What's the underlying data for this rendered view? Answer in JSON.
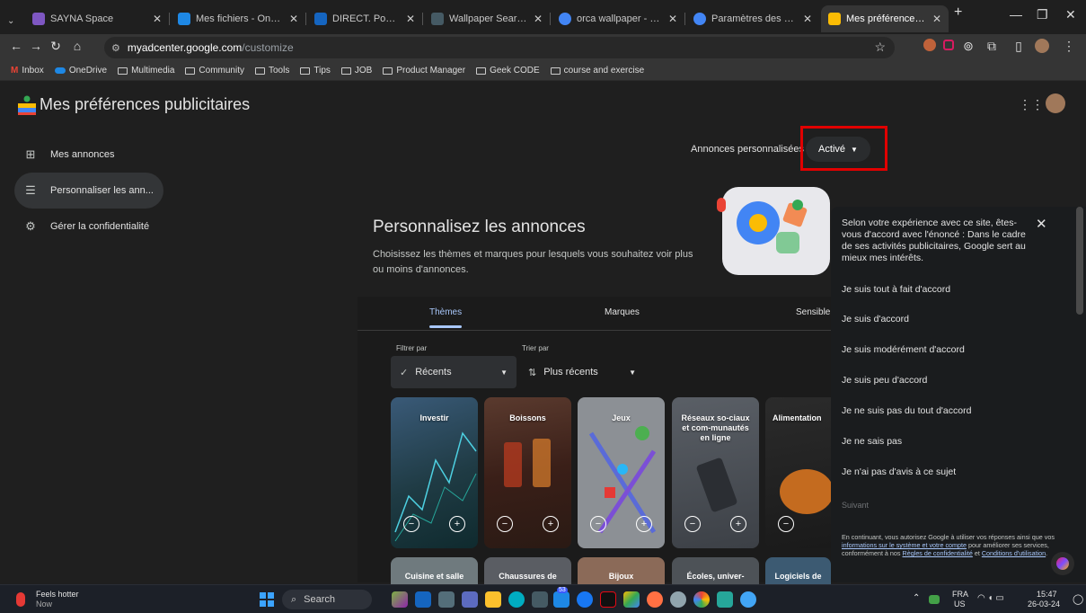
{
  "browser": {
    "tabs": [
      {
        "title": "SAYNA Space",
        "color": "#7e57c2"
      },
      {
        "title": "Mes fichiers - OneDrive",
        "color": "#1e88e5"
      },
      {
        "title": "DIRECT. Pont effondré à B",
        "color": "#1565c0"
      },
      {
        "title": "Wallpaper Search: orca -",
        "color": "#455a64"
      },
      {
        "title": "orca wallpaper - Recherch",
        "color": "#4285f4"
      },
      {
        "title": "Paramètres des annonces",
        "color": "#4285f4"
      },
      {
        "title": "Mes préférences publicita",
        "color": "#fbbc04"
      }
    ],
    "new_tab": "+",
    "address_host": "myadcenter.google.com",
    "address_path": "/customize",
    "bookmarks": [
      "Inbox",
      "OneDrive",
      "Multimedia",
      "Community",
      "Tools",
      "Tips",
      "JOB",
      "Product Manager",
      "Geek CODE",
      "course and exercise"
    ]
  },
  "app": {
    "title": "Mes préférences publicitaires",
    "sidebar": [
      {
        "label": "Mes annonces",
        "icon": "ads-grid-icon"
      },
      {
        "label": "Personnaliser les ann...",
        "icon": "tune-icon"
      },
      {
        "label": "Gérer la confidentialité",
        "icon": "privacy-icon"
      }
    ],
    "personalized_label": "Annonces personnalisées",
    "active_label": "Activé",
    "heading": "Personnalisez les annonces",
    "description": "Choisissez les thèmes et marques pour lesquels vous souhaitez voir plus ou moins d'annonces.",
    "content_tabs": [
      "Thèmes",
      "Marques",
      "Sensible"
    ],
    "filter": {
      "label": "Filtrer par",
      "value": "Récents"
    },
    "sort": {
      "label": "Trier par",
      "value": "Plus récents"
    },
    "cards": [
      "Investir",
      "Boissons",
      "Jeux",
      "Réseaux so-ciaux et com-munautés en ligne",
      "Alimentation"
    ],
    "cards_row2": [
      "Cuisine et salle",
      "Chaussures de",
      "Bijoux",
      "Écoles, univer-",
      "Logiciels de"
    ]
  },
  "survey": {
    "question": "Selon votre expérience avec ce site, êtes-vous d'accord avec l'énoncé : Dans le cadre de ses activités publicitaires, Google sert au mieux mes intérêts.",
    "options": [
      "Je suis tout à fait d'accord",
      "Je suis d'accord",
      "Je suis modérément d'accord",
      "Je suis peu d'accord",
      "Je ne suis pas du tout d'accord",
      "Je ne sais pas",
      "Je n'ai pas d'avis à ce sujet"
    ],
    "next": "Suivant",
    "fine_a": "En continuant, vous autorisez Google à utiliser vos réponses ainsi que vos ",
    "fine_link1": "informations sur le système et votre compte",
    "fine_b": " pour améliorer ses services, conformément à nos ",
    "fine_link2": "Règles de confidentialité",
    "fine_c": " et ",
    "fine_link3": "Conditions d'utilisation",
    "fine_d": "."
  },
  "taskbar": {
    "weather_title": "Feels hotter",
    "weather_sub": "Now",
    "search": "Search",
    "lang_top": "FRA",
    "lang_bottom": "US",
    "time": "15:47",
    "date": "26-03-24",
    "badge": "53"
  },
  "colors": {
    "highlight": "#e10000",
    "accent": "#a8c7fa"
  }
}
